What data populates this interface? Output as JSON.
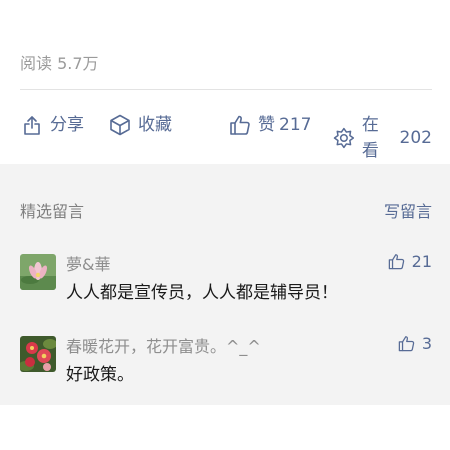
{
  "article": {
    "read_count": "阅读 5.7万"
  },
  "actions": {
    "share": {
      "label": "分享",
      "icon": "share-icon"
    },
    "favorite": {
      "label": "收藏",
      "icon": "box-icon"
    },
    "like": {
      "label": "赞",
      "count": "217",
      "icon": "thumb-up-icon"
    },
    "looking": {
      "label": "在看",
      "count": "202",
      "icon": "flower-icon"
    }
  },
  "comments": {
    "title": "精选留言",
    "write_label": "写留言",
    "items": [
      {
        "nickname": "夢&華",
        "text": "人人都是宣传员，人人都是辅导员！",
        "likes": "21",
        "avatar": "lotus-avatar"
      },
      {
        "nickname": "春暖花开，花开富贵。^_^",
        "text": "好政策。",
        "likes": "3",
        "avatar": "flowers-avatar"
      }
    ]
  },
  "colors": {
    "link": "#576b95",
    "muted": "#9b9b9b",
    "section_bg": "#f3f3f3"
  }
}
